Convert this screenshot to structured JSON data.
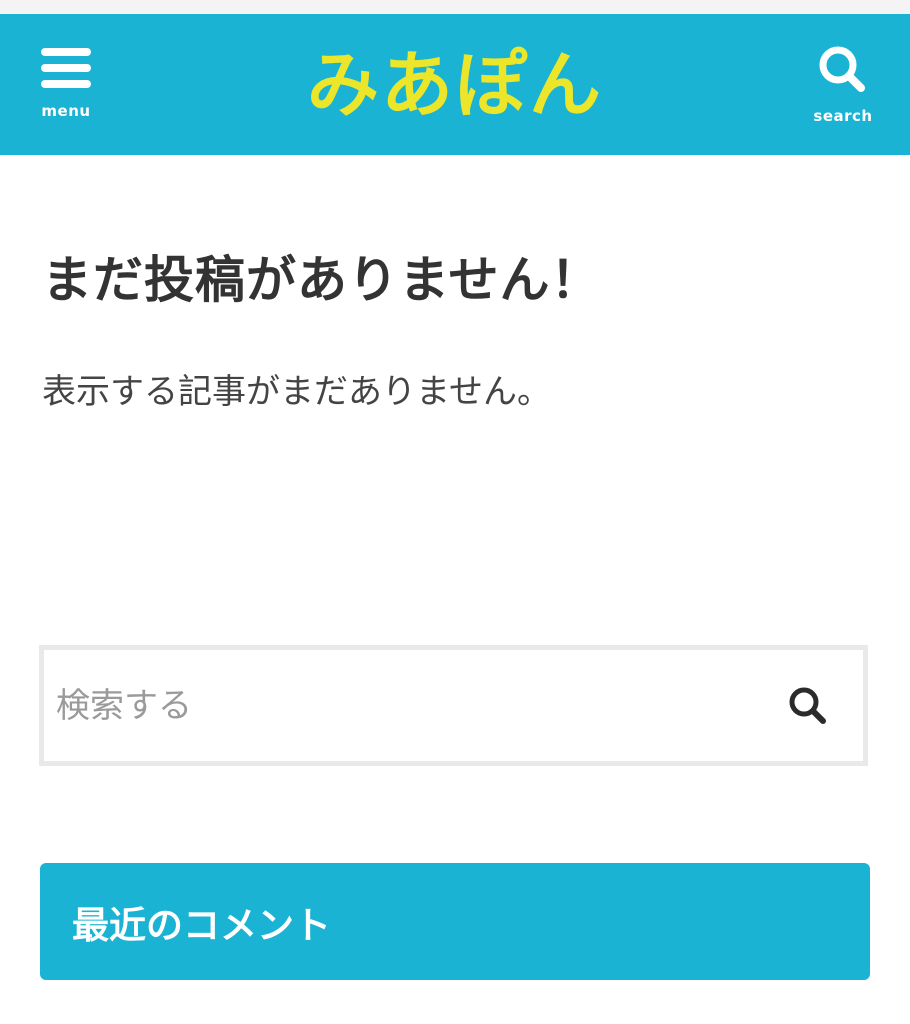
{
  "header": {
    "logo_text": "みあぽん",
    "menu_label": "menu",
    "search_label": "search",
    "background_color": "#1ab3d3",
    "logo_color": "#ece62a"
  },
  "main": {
    "title": "まだ投稿がありません！",
    "message": "表示する記事がまだありません。"
  },
  "search_form": {
    "placeholder": "検索する",
    "submit_icon": "search-icon"
  },
  "widget": {
    "title": "最近のコメント"
  }
}
